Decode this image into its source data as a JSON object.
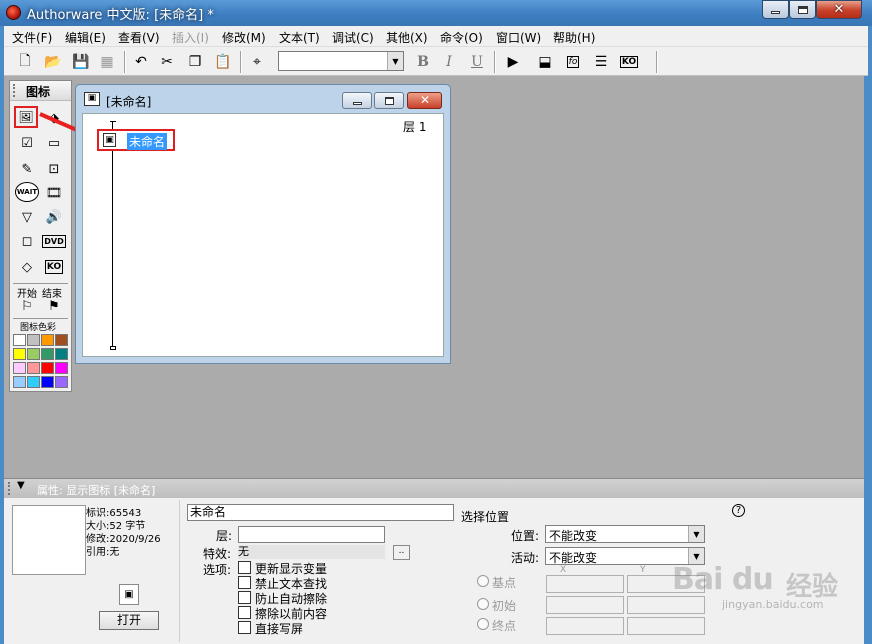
{
  "window": {
    "title": "Authorware 中文版: [未命名] *"
  },
  "menubar": [
    "文件(F)",
    "编辑(E)",
    "查看(V)",
    "插入(I)",
    "修改(M)",
    "文本(T)",
    "调试(C)",
    "其他(X)",
    "命令(O)",
    "窗口(W)",
    "帮助(H)"
  ],
  "toolbar": {
    "bold": "B",
    "italic": "I",
    "underline": "U",
    "fo_label": "fo",
    "ko_label": "KO"
  },
  "palette": {
    "title": "图标",
    "start_label": "开始",
    "end_label": "结束",
    "color_title": "图标色彩",
    "wait_label": "WAIT",
    "dvd_label": "DVD",
    "ko_label": "KO",
    "swatches": [
      "#ffffff",
      "#c0c0c0",
      "#ff9900",
      "#a05020",
      "#ffff00",
      "#99cc66",
      "#339966",
      "#008080",
      "#ffccff",
      "#ff9999",
      "#ff0000",
      "#ff00ff",
      "#99ccff",
      "#33ccff",
      "#0000ff",
      "#9966ff"
    ]
  },
  "flowline_window": {
    "title": "[未命名]",
    "level_label": "层 1",
    "icon_label": "未命名"
  },
  "properties": {
    "header": "属性: 显示图标 [未命名]",
    "id_line": "标识:65543",
    "size_line": "大小:52 字节",
    "modified_line": "修改:2020/9/26",
    "ref_line": "引用:无",
    "open_button": "打开",
    "name_value": "未命名",
    "layer_label": "层:",
    "layer_value": "",
    "effect_label": "特效:",
    "effect_value": "无",
    "effect_button": "..",
    "options_label": "选项:",
    "options": [
      "更新显示变量",
      "禁止文本查找",
      "防止自动擦除",
      "擦除以前内容",
      "直接写屏"
    ],
    "position_section": "选择位置",
    "position_label": "位置:",
    "position_value": "不能改变",
    "activity_label": "活动:",
    "activity_value": "不能改变",
    "base_label": "基点",
    "initial_label": "初始",
    "end_label": "终点",
    "x_label": "X",
    "y_label": "Y",
    "help": "?"
  },
  "watermark": {
    "brand": "Bai du",
    "sub": "经验",
    "url": "jingyan.baidu.com"
  }
}
